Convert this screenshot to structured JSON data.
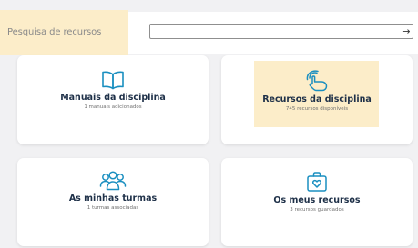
{
  "search": {
    "label": "Pesquisa de recursos",
    "value": "",
    "placeholder": "",
    "submit_icon": "arrow-right-icon"
  },
  "cards": [
    {
      "title": "Manuais da disciplina",
      "subtitle": "1 manuais adicionados",
      "icon": "open-book-icon",
      "highlighted": false
    },
    {
      "title": "Recursos da disciplina",
      "subtitle": "745 recursos disponíveis",
      "icon": "touch-hand-icon",
      "highlighted": true
    },
    {
      "title": "As minhas turmas",
      "subtitle": "1 turmas associadas",
      "icon": "group-people-icon",
      "highlighted": false
    },
    {
      "title": "Os meus recursos",
      "subtitle": "3 recursos guardados",
      "icon": "briefcase-heart-icon",
      "highlighted": false
    }
  ],
  "colors": {
    "accent": "#1a8fc0",
    "highlight": "#fcedc9",
    "title": "#1e3048",
    "background": "#f1f1f3"
  }
}
